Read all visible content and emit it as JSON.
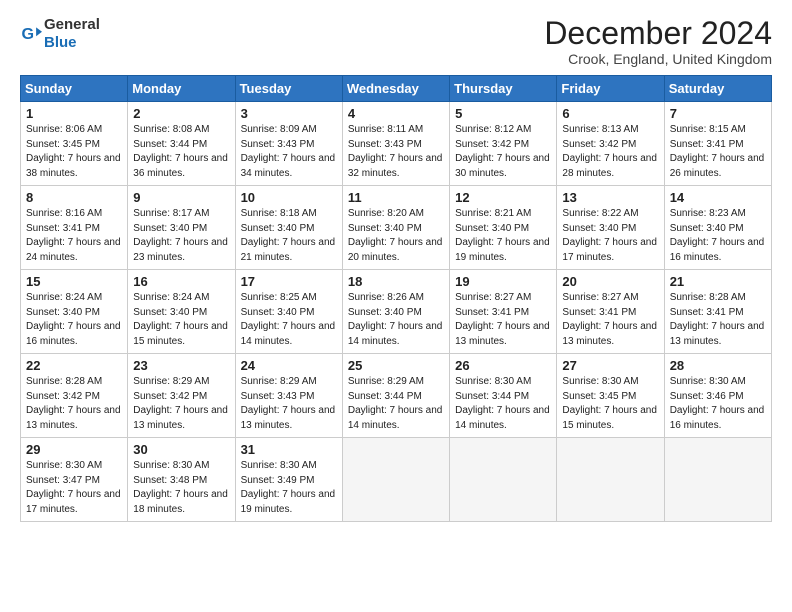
{
  "header": {
    "logo_general": "General",
    "logo_blue": "Blue",
    "title": "December 2024",
    "location": "Crook, England, United Kingdom"
  },
  "columns": [
    "Sunday",
    "Monday",
    "Tuesday",
    "Wednesday",
    "Thursday",
    "Friday",
    "Saturday"
  ],
  "weeks": [
    [
      {
        "day": "1",
        "sunrise": "8:06 AM",
        "sunset": "3:45 PM",
        "daylight": "7 hours and 38 minutes."
      },
      {
        "day": "2",
        "sunrise": "8:08 AM",
        "sunset": "3:44 PM",
        "daylight": "7 hours and 36 minutes."
      },
      {
        "day": "3",
        "sunrise": "8:09 AM",
        "sunset": "3:43 PM",
        "daylight": "7 hours and 34 minutes."
      },
      {
        "day": "4",
        "sunrise": "8:11 AM",
        "sunset": "3:43 PM",
        "daylight": "7 hours and 32 minutes."
      },
      {
        "day": "5",
        "sunrise": "8:12 AM",
        "sunset": "3:42 PM",
        "daylight": "7 hours and 30 minutes."
      },
      {
        "day": "6",
        "sunrise": "8:13 AM",
        "sunset": "3:42 PM",
        "daylight": "7 hours and 28 minutes."
      },
      {
        "day": "7",
        "sunrise": "8:15 AM",
        "sunset": "3:41 PM",
        "daylight": "7 hours and 26 minutes."
      }
    ],
    [
      {
        "day": "8",
        "sunrise": "8:16 AM",
        "sunset": "3:41 PM",
        "daylight": "7 hours and 24 minutes."
      },
      {
        "day": "9",
        "sunrise": "8:17 AM",
        "sunset": "3:40 PM",
        "daylight": "7 hours and 23 minutes."
      },
      {
        "day": "10",
        "sunrise": "8:18 AM",
        "sunset": "3:40 PM",
        "daylight": "7 hours and 21 minutes."
      },
      {
        "day": "11",
        "sunrise": "8:20 AM",
        "sunset": "3:40 PM",
        "daylight": "7 hours and 20 minutes."
      },
      {
        "day": "12",
        "sunrise": "8:21 AM",
        "sunset": "3:40 PM",
        "daylight": "7 hours and 19 minutes."
      },
      {
        "day": "13",
        "sunrise": "8:22 AM",
        "sunset": "3:40 PM",
        "daylight": "7 hours and 17 minutes."
      },
      {
        "day": "14",
        "sunrise": "8:23 AM",
        "sunset": "3:40 PM",
        "daylight": "7 hours and 16 minutes."
      }
    ],
    [
      {
        "day": "15",
        "sunrise": "8:24 AM",
        "sunset": "3:40 PM",
        "daylight": "7 hours and 16 minutes."
      },
      {
        "day": "16",
        "sunrise": "8:24 AM",
        "sunset": "3:40 PM",
        "daylight": "7 hours and 15 minutes."
      },
      {
        "day": "17",
        "sunrise": "8:25 AM",
        "sunset": "3:40 PM",
        "daylight": "7 hours and 14 minutes."
      },
      {
        "day": "18",
        "sunrise": "8:26 AM",
        "sunset": "3:40 PM",
        "daylight": "7 hours and 14 minutes."
      },
      {
        "day": "19",
        "sunrise": "8:27 AM",
        "sunset": "3:41 PM",
        "daylight": "7 hours and 13 minutes."
      },
      {
        "day": "20",
        "sunrise": "8:27 AM",
        "sunset": "3:41 PM",
        "daylight": "7 hours and 13 minutes."
      },
      {
        "day": "21",
        "sunrise": "8:28 AM",
        "sunset": "3:41 PM",
        "daylight": "7 hours and 13 minutes."
      }
    ],
    [
      {
        "day": "22",
        "sunrise": "8:28 AM",
        "sunset": "3:42 PM",
        "daylight": "7 hours and 13 minutes."
      },
      {
        "day": "23",
        "sunrise": "8:29 AM",
        "sunset": "3:42 PM",
        "daylight": "7 hours and 13 minutes."
      },
      {
        "day": "24",
        "sunrise": "8:29 AM",
        "sunset": "3:43 PM",
        "daylight": "7 hours and 13 minutes."
      },
      {
        "day": "25",
        "sunrise": "8:29 AM",
        "sunset": "3:44 PM",
        "daylight": "7 hours and 14 minutes."
      },
      {
        "day": "26",
        "sunrise": "8:30 AM",
        "sunset": "3:44 PM",
        "daylight": "7 hours and 14 minutes."
      },
      {
        "day": "27",
        "sunrise": "8:30 AM",
        "sunset": "3:45 PM",
        "daylight": "7 hours and 15 minutes."
      },
      {
        "day": "28",
        "sunrise": "8:30 AM",
        "sunset": "3:46 PM",
        "daylight": "7 hours and 16 minutes."
      }
    ],
    [
      {
        "day": "29",
        "sunrise": "8:30 AM",
        "sunset": "3:47 PM",
        "daylight": "7 hours and 17 minutes."
      },
      {
        "day": "30",
        "sunrise": "8:30 AM",
        "sunset": "3:48 PM",
        "daylight": "7 hours and 18 minutes."
      },
      {
        "day": "31",
        "sunrise": "8:30 AM",
        "sunset": "3:49 PM",
        "daylight": "7 hours and 19 minutes."
      },
      null,
      null,
      null,
      null
    ]
  ]
}
